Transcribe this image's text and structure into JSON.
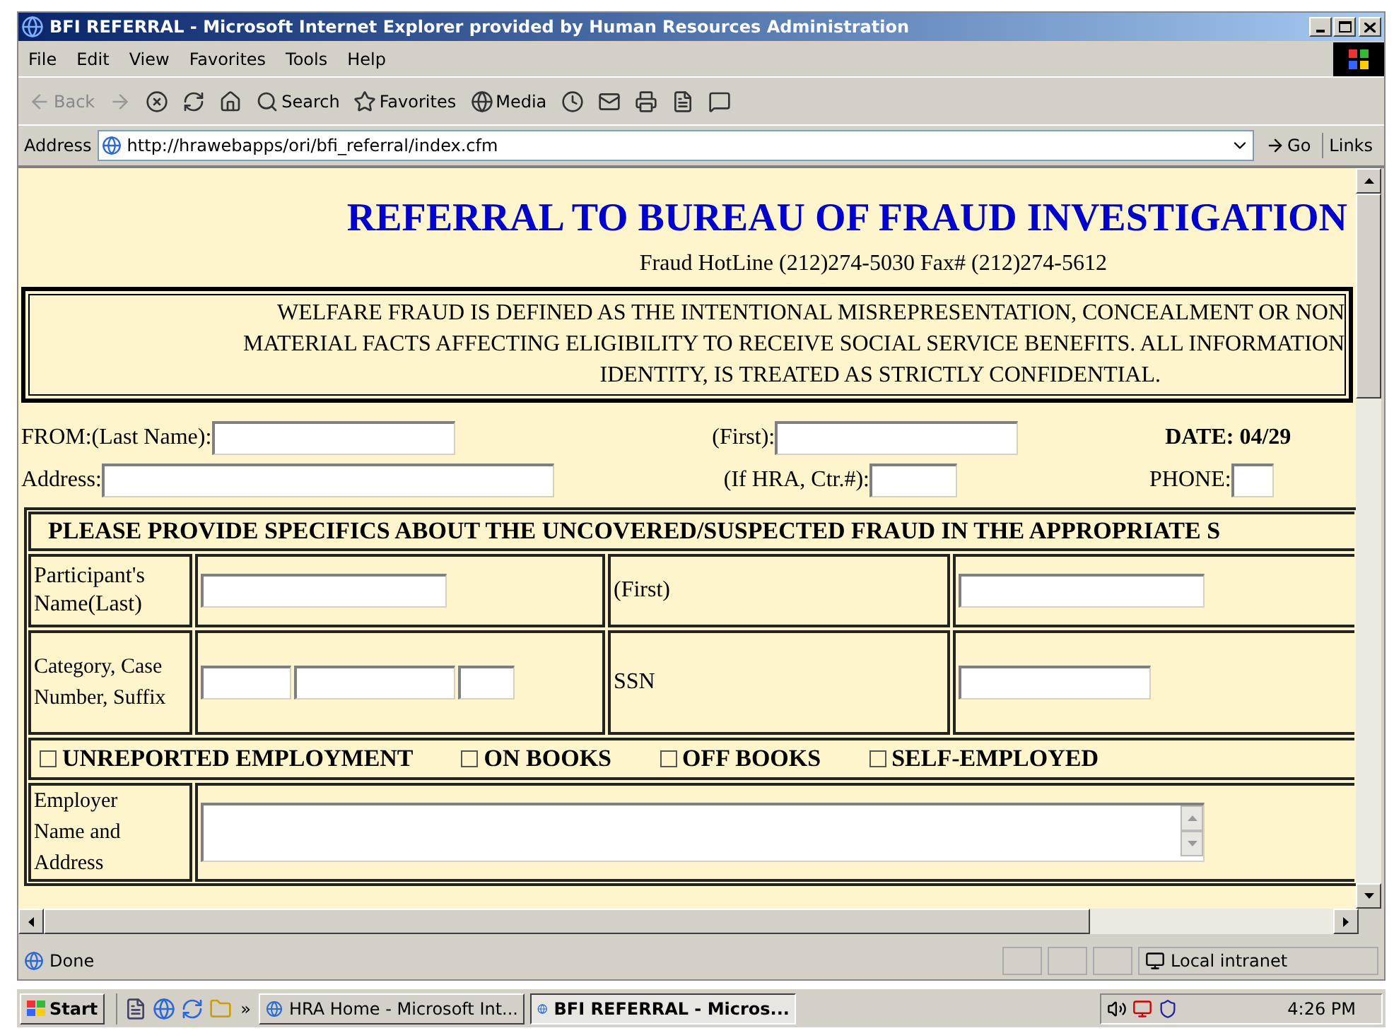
{
  "window": {
    "title": "BFI REFERRAL - Microsoft Internet Explorer provided by Human Resources Administration"
  },
  "menu": [
    "File",
    "Edit",
    "View",
    "Favorites",
    "Tools",
    "Help"
  ],
  "toolbar": [
    {
      "kind": "back",
      "label": "Back",
      "disabled": true
    },
    {
      "kind": "forward",
      "disabled": true
    },
    {
      "kind": "stop"
    },
    {
      "kind": "refresh"
    },
    {
      "kind": "home"
    },
    {
      "kind": "search",
      "label": "Search"
    },
    {
      "kind": "favorites",
      "label": "Favorites"
    },
    {
      "kind": "media",
      "label": "Media"
    },
    {
      "kind": "history"
    },
    {
      "kind": "mail"
    },
    {
      "kind": "print"
    },
    {
      "kind": "edit"
    },
    {
      "kind": "discuss"
    }
  ],
  "address_bar": {
    "label": "Address",
    "url": "http://hrawebapps/ori/bfi_referral/index.cfm",
    "go": "Go",
    "links": "Links"
  },
  "page": {
    "heading": "REFERRAL TO BUREAU OF FRAUD INVESTIGATION",
    "hotline": "Fraud HotLine (212)274-5030 Fax# (212)274-5612",
    "notice_lines": [
      "WELFARE FRAUD IS DEFINED AS THE INTENTIONAL MISREPRESENTATION, CONCEALMENT OR NON",
      "MATERIAL FACTS AFFECTING ELIGIBILITY TO RECEIVE SOCIAL SERVICE BENEFITS. ALL INFORMATION",
      "IDENTITY, IS TREATED AS STRICTLY CONFIDENTIAL."
    ],
    "from_last_label": "FROM:(Last Name):",
    "from_first_label": "(First):",
    "date": "DATE: 04/29",
    "address_label": "Address:",
    "hra_label": "(If HRA, Ctr.#):",
    "phone_label": "PHONE:",
    "section_header": "PLEASE PROVIDE SPECIFICS ABOUT THE UNCOVERED/SUSPECTED FRAUD IN THE APPROPRIATE S",
    "participant_label": "Participant's Name(Last)",
    "participant_first_label": "(First)",
    "category_label": "Category, Case Number, Suffix",
    "ssn_label": "SSN",
    "checkboxes": [
      {
        "label": "UNREPORTED EMPLOYMENT",
        "checked": false
      },
      {
        "label": "ON BOOKS",
        "checked": false
      },
      {
        "label": "OFF BOOKS",
        "checked": false
      },
      {
        "label": "SELF-EMPLOYED",
        "checked": false
      }
    ],
    "employer_label": "Employer Name and Address"
  },
  "status_bar": {
    "text": "Done",
    "zone": "Local intranet"
  },
  "taskbar": {
    "start": "Start",
    "more": "»",
    "tasks": [
      {
        "label": "HRA Home - Microsoft Int...",
        "selected": false
      },
      {
        "label": "BFI REFERRAL - Micros...",
        "selected": true
      }
    ],
    "clock": "4:26 PM"
  }
}
